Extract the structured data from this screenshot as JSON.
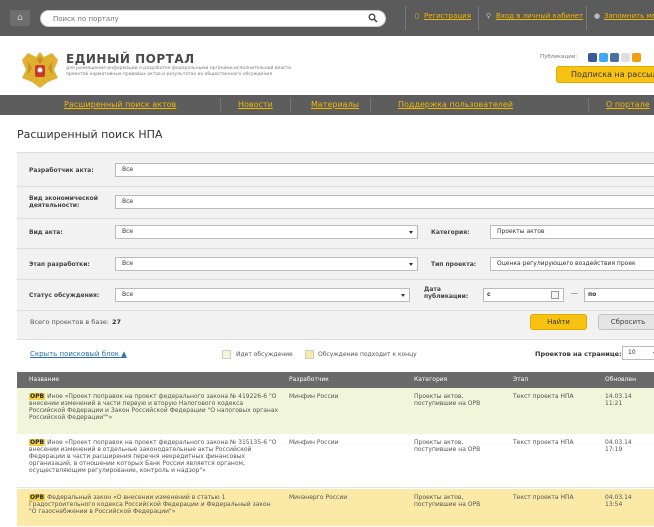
{
  "topbar": {
    "search_placeholder": "Поиск по порталу",
    "register_label": "Регистрация",
    "login_label": "Вход в личный кабинет",
    "remember_label": "Запомнить ме"
  },
  "header": {
    "title": "ЕДИНЫЙ ПОРТАЛ",
    "subtitle": "для размещения информации о разработке федеральными органами исполнительной власти проектов нормативных правовых актов и результатах их общественного обсуждения",
    "publications_label": "Публикации:",
    "subscribe_label": "Подписка на рассылку"
  },
  "nav": {
    "items": [
      "Расширенный поиск актов",
      "Новости",
      "Материалы",
      "Поддержка пользователей",
      "О портале"
    ]
  },
  "page_title": "Расширенный поиск НПА",
  "filters": {
    "developer": {
      "label": "Разработчик акта:",
      "value": "Все"
    },
    "activity": {
      "label": "Вид экономической деятельности:",
      "value": "Все"
    },
    "act_type": {
      "label": "Вид акта:",
      "value": "Все"
    },
    "category": {
      "label": "Категория:",
      "value": "Проекты актов"
    },
    "stage": {
      "label": "Этап разработки:",
      "value": "Все"
    },
    "project_type": {
      "label": "Тип проекта:",
      "value": "Оценка регулирующего воздействия проек"
    },
    "status": {
      "label": "Статус обсуждения:",
      "value": "Все"
    },
    "pub_date": {
      "label": "Дата публикации:",
      "from": "с",
      "dash": "—",
      "to": "по"
    }
  },
  "totals": {
    "label": "Всего проектов в базе:",
    "count": "27"
  },
  "buttons": {
    "find": "Найти",
    "reset": "Сбросить"
  },
  "options": {
    "hide_link": "Скрыть поисковый блок ▲",
    "legend_active": "Идет обсуждение",
    "legend_ending": "Обсуждение подходит к концу",
    "per_page_label": "Проектов на странице:",
    "per_page_value": "10"
  },
  "colors": {
    "active_row": "#f1f5d9",
    "ending_row": "#fbe9a8",
    "accent": "#f7c313"
  },
  "table": {
    "headers": [
      "Название",
      "Разработчик",
      "Категория",
      "Этап",
      "Обновлен"
    ],
    "rows": [
      {
        "badge": "ОРВ",
        "title": "Иное «Проект поправок на проект федерального закона № 419226-6 \"О внесении изменений в части первую и вторую Налогового кодекса Российской Федерации и Закон Российской Федерации \"О налоговых органах Российской Федерации\"\"»",
        "developer": "Минфин России",
        "category": "Проекты актов, поступившие на ОРВ",
        "stage": "Текст проекта НПА",
        "date": "14.03.14",
        "time": "11:21"
      },
      {
        "badge": "ОРВ",
        "title": "Иное «Проект поправок на проект федерального закона № 315135-6 \"О внесении изменений в отдельные законодательные акты Российской Федерации в части расширения перечня некредитных финансовых организаций, в отношении которых Банк России является органом, осуществляющим регулирование, контроль и надзор\"»",
        "developer": "Минфин России",
        "category": "Проекты актов, поступившие на ОРВ",
        "stage": "Текст проекта НПА",
        "date": "04.03.14",
        "time": "17:19"
      },
      {
        "badge": "ОРВ",
        "title": "Федеральный закон «О внесении изменений в статью 1 Градостроительного кодекса Российской Федерации и Федеральный закон \"О газоснабжении в Российской Федерации\"»",
        "developer": "Минэнерго России",
        "category": "Проекты актов, поступившие на ОРВ",
        "stage": "Текст проекта НПА",
        "date": "04.03.14",
        "time": "13:54"
      }
    ]
  }
}
